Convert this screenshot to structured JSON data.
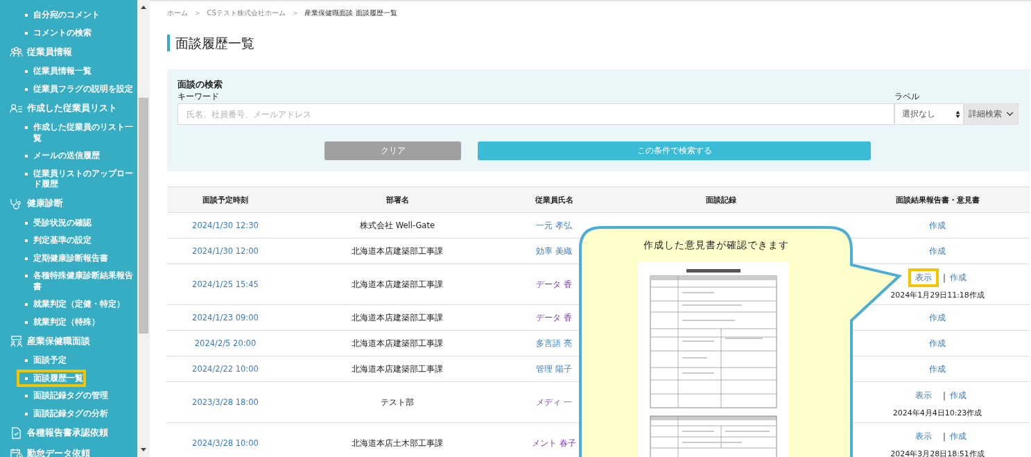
{
  "sidebar": {
    "items": [
      {
        "kind": "item",
        "label": "自分宛のコメント",
        "highlighted": false
      },
      {
        "kind": "item",
        "label": "コメントの検索",
        "highlighted": false
      },
      {
        "kind": "heading",
        "label": "従業員情報",
        "highlighted": false
      },
      {
        "kind": "item",
        "label": "従業員情報一覧",
        "highlighted": false
      },
      {
        "kind": "item",
        "label": "従業員フラグの説明を設定",
        "highlighted": false
      },
      {
        "kind": "heading",
        "label": "作成した従業員リスト",
        "highlighted": false
      },
      {
        "kind": "item",
        "label": "作成した従業員のリスト一覧",
        "highlighted": false
      },
      {
        "kind": "item",
        "label": "メールの送信履歴",
        "highlighted": false
      },
      {
        "kind": "item",
        "label": "従業員リストのアップロード履歴",
        "highlighted": false
      },
      {
        "kind": "heading",
        "label": "健康診断",
        "highlighted": false
      },
      {
        "kind": "item",
        "label": "受診状況の確認",
        "highlighted": false
      },
      {
        "kind": "item",
        "label": "判定基準の設定",
        "highlighted": false
      },
      {
        "kind": "item",
        "label": "定期健康診断報告書",
        "highlighted": false
      },
      {
        "kind": "item",
        "label": "各種特殊健康診断結果報告書",
        "highlighted": false
      },
      {
        "kind": "item",
        "label": "就業判定（定健・特定）",
        "highlighted": false
      },
      {
        "kind": "item",
        "label": "就業判定（特殊）",
        "highlighted": false
      },
      {
        "kind": "heading",
        "label": "産業保健職面談",
        "highlighted": false
      },
      {
        "kind": "item",
        "label": "面談予定",
        "highlighted": false
      },
      {
        "kind": "item",
        "label": "面談履歴一覧",
        "highlighted": true
      },
      {
        "kind": "item",
        "label": "面談記録タグの管理",
        "highlighted": false
      },
      {
        "kind": "item",
        "label": "面談記録タグの分析",
        "highlighted": false
      },
      {
        "kind": "heading",
        "label": "各種報告書承認依頼",
        "highlighted": false
      },
      {
        "kind": "heading",
        "label": "勤怠データ依頼",
        "highlighted": false
      }
    ]
  },
  "breadcrumb": [
    {
      "label": "ホーム",
      "current": false
    },
    {
      "label": "CSテスト株式会社ホーム",
      "current": false
    },
    {
      "label": "産業保健職面談 面談履歴一覧",
      "current": true
    }
  ],
  "breadcrumb_separator": ">",
  "page_title": "面談履歴一覧",
  "search": {
    "title": "面談の検索",
    "keyword_label": "キーワード",
    "placeholder": "氏名、社員番号、メールアドレス",
    "label_label": "ラベル",
    "label_value": "選択なし",
    "advanced": "詳細検索",
    "clear": "クリア",
    "submit": "この条件で検索する"
  },
  "table": {
    "columns": [
      "面談予定時刻",
      "部署名",
      "従業員氏名",
      "面談記録",
      "面談結果報告書・意見書"
    ],
    "rows": [
      {
        "tall": false,
        "date": "2024/1/30 12:30",
        "department": "株式会社 Well-Gate",
        "employee": "一元 孝弘",
        "visited": false,
        "create": "作成"
      },
      {
        "tall": false,
        "date": "2024/1/30 12:00",
        "department": "北海道本店建築部工事課",
        "employee": "効率 美織",
        "visited": false,
        "create": "作成"
      },
      {
        "tall": true,
        "date": "2024/1/25 15:45",
        "department": "北海道本店建築部工事課",
        "employee": "データ 香",
        "visited": true,
        "view": "表示",
        "view_highlighted": true,
        "create": "作成",
        "created_at": "2024年1月29日11:18作成"
      },
      {
        "tall": false,
        "date": "2024/1/23 09:00",
        "department": "北海道本店建築部工事課",
        "employee": "データ 香",
        "visited": true,
        "create": "作成"
      },
      {
        "tall": false,
        "date": "2024/2/5 20:00",
        "department": "北海道本店建築部工事課",
        "employee": "多言語 亮",
        "visited": false,
        "create": "作成"
      },
      {
        "tall": false,
        "date": "2024/2/22 10:00",
        "department": "北海道本店建築部工事課",
        "employee": "管理 陽子",
        "visited": false,
        "create": "作成"
      },
      {
        "tall": true,
        "date": "2023/3/28 18:00",
        "department": "テスト部",
        "employee": "メディ 一",
        "visited": true,
        "view": "表示",
        "view_highlighted": false,
        "create": "作成",
        "created_at": "2024年4月4日10:23作成"
      },
      {
        "tall": true,
        "date": "2024/3/28 10:00",
        "department": "北海道本店土木部工事課",
        "employee": "メント 春子",
        "visited": true,
        "view": "表示",
        "view_highlighted": false,
        "create": "作成",
        "created_at": "2024年3月28日18:51作成"
      }
    ],
    "link_separator": "|"
  },
  "callout": {
    "text": "作成した意見書が確認できます"
  }
}
